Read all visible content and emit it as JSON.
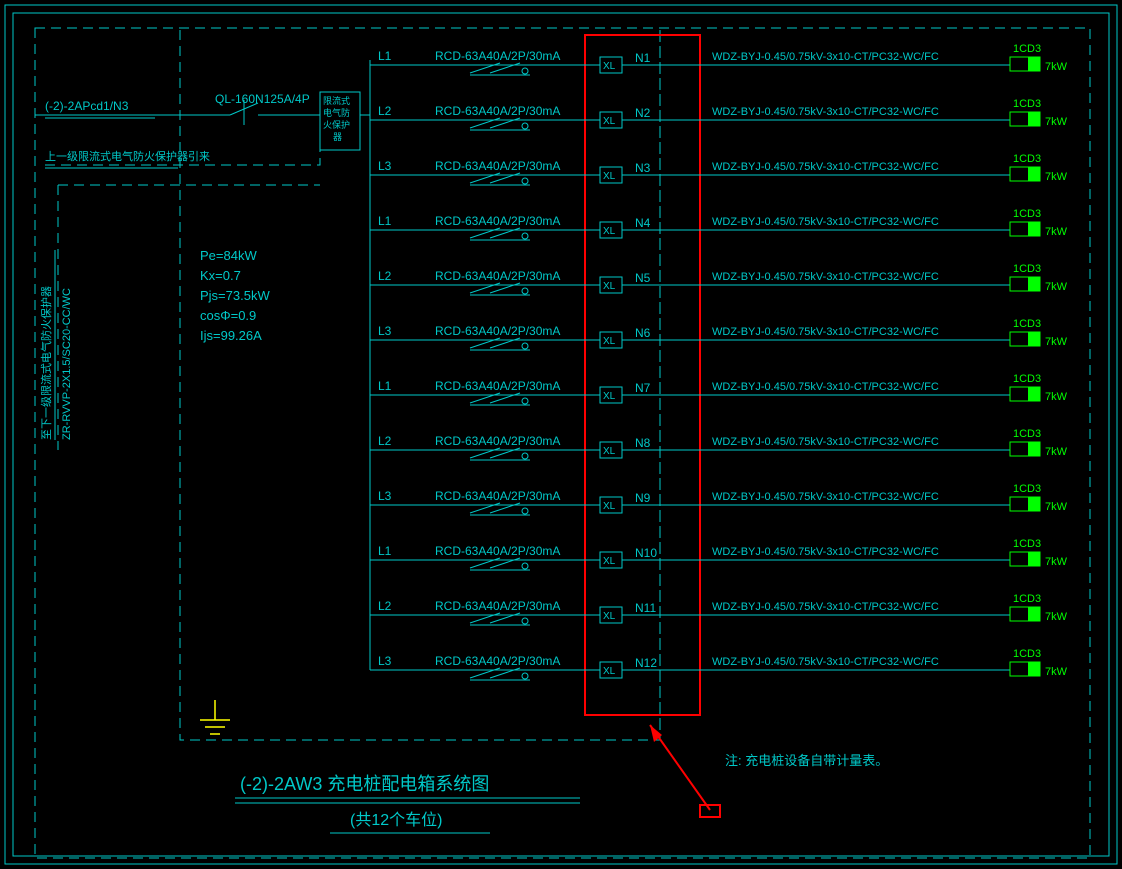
{
  "title_main": "(-2)-2AW3 充电桩配电箱系统图",
  "title_sub": "(共12个车位)",
  "note": "注: 充电桩设备自带计量表。",
  "incoming": {
    "source": "(-2)-2APcd1/N3",
    "breaker": "QL-160N125A/4P",
    "device_block": "限流式\n电气防火\n保护器"
  },
  "fire_line_upper": "上一级限流式电气防火保护器引来",
  "fire_line_lower_a": "至下一级限流式电气防火保护器",
  "fire_line_lower_b": "ZR-RVVP-2X1.5/SC20-CC/WC",
  "params": {
    "Pe": "Pe=84kW",
    "Kx": "Kx=0.7",
    "Pjs": "Pjs=73.5kW",
    "cos": "cosΦ=0.9",
    "Ijs": "Ijs=99.26A"
  },
  "circuits": [
    {
      "phase": "L1",
      "rcd": "RCD-63A40A/2P/30mA",
      "xl": "XL",
      "n": "N1",
      "cable": "WDZ-BYJ-0.45/0.75kV-3x10-CT/PC32-WC/FC",
      "load": "1CD3",
      "kw": "7kW"
    },
    {
      "phase": "L2",
      "rcd": "RCD-63A40A/2P/30mA",
      "xl": "XL",
      "n": "N2",
      "cable": "WDZ-BYJ-0.45/0.75kV-3x10-CT/PC32-WC/FC",
      "load": "1CD3",
      "kw": "7kW"
    },
    {
      "phase": "L3",
      "rcd": "RCD-63A40A/2P/30mA",
      "xl": "XL",
      "n": "N3",
      "cable": "WDZ-BYJ-0.45/0.75kV-3x10-CT/PC32-WC/FC",
      "load": "1CD3",
      "kw": "7kW"
    },
    {
      "phase": "L1",
      "rcd": "RCD-63A40A/2P/30mA",
      "xl": "XL",
      "n": "N4",
      "cable": "WDZ-BYJ-0.45/0.75kV-3x10-CT/PC32-WC/FC",
      "load": "1CD3",
      "kw": "7kW"
    },
    {
      "phase": "L2",
      "rcd": "RCD-63A40A/2P/30mA",
      "xl": "XL",
      "n": "N5",
      "cable": "WDZ-BYJ-0.45/0.75kV-3x10-CT/PC32-WC/FC",
      "load": "1CD3",
      "kw": "7kW"
    },
    {
      "phase": "L3",
      "rcd": "RCD-63A40A/2P/30mA",
      "xl": "XL",
      "n": "N6",
      "cable": "WDZ-BYJ-0.45/0.75kV-3x10-CT/PC32-WC/FC",
      "load": "1CD3",
      "kw": "7kW"
    },
    {
      "phase": "L1",
      "rcd": "RCD-63A40A/2P/30mA",
      "xl": "XL",
      "n": "N7",
      "cable": "WDZ-BYJ-0.45/0.75kV-3x10-CT/PC32-WC/FC",
      "load": "1CD3",
      "kw": "7kW"
    },
    {
      "phase": "L2",
      "rcd": "RCD-63A40A/2P/30mA",
      "xl": "XL",
      "n": "N8",
      "cable": "WDZ-BYJ-0.45/0.75kV-3x10-CT/PC32-WC/FC",
      "load": "1CD3",
      "kw": "7kW"
    },
    {
      "phase": "L3",
      "rcd": "RCD-63A40A/2P/30mA",
      "xl": "XL",
      "n": "N9",
      "cable": "WDZ-BYJ-0.45/0.75kV-3x10-CT/PC32-WC/FC",
      "load": "1CD3",
      "kw": "7kW"
    },
    {
      "phase": "L1",
      "rcd": "RCD-63A40A/2P/30mA",
      "xl": "XL",
      "n": "N10",
      "cable": "WDZ-BYJ-0.45/0.75kV-3x10-CT/PC32-WC/FC",
      "load": "1CD3",
      "kw": "7kW"
    },
    {
      "phase": "L2",
      "rcd": "RCD-63A40A/2P/30mA",
      "xl": "XL",
      "n": "N11",
      "cable": "WDZ-BYJ-0.45/0.75kV-3x10-CT/PC32-WC/FC",
      "load": "1CD3",
      "kw": "7kW"
    },
    {
      "phase": "L3",
      "rcd": "RCD-63A40A/2P/30mA",
      "xl": "XL",
      "n": "N12",
      "cable": "WDZ-BYJ-0.45/0.75kV-3x10-CT/PC32-WC/FC",
      "load": "1CD3",
      "kw": "7kW"
    }
  ]
}
